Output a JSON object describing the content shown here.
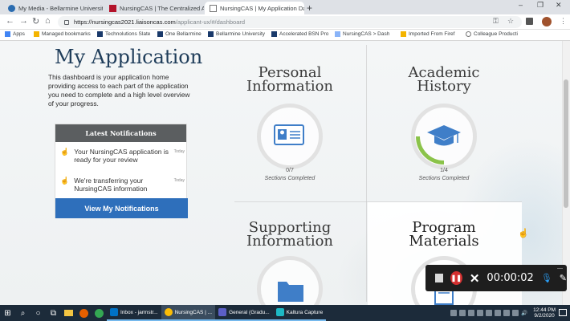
{
  "browser": {
    "tabs": [
      {
        "title": "My Media - Bellarmine Universit",
        "active": false
      },
      {
        "title": "NursingCAS | The Centralized Ap",
        "active": false
      },
      {
        "title": "NursingCAS | My Application Da",
        "active": true
      }
    ],
    "url_host": "https://nursingcas2021.liaisoncas.com",
    "url_path": "/applicant-ux/#/dashboard",
    "bookmarks": [
      "Apps",
      "Managed bookmarks",
      "Technolutions Slate",
      "One Bellarmine",
      "Bellarmine University",
      "Accelerated BSN Pro",
      "NursingCAS > Dash",
      "Imported From Firef",
      "Colleague Producti"
    ]
  },
  "page": {
    "title": "My Application",
    "intro": "This dashboard is your application home providing access to each part of the application you need to complete and a high level overview of your progress.",
    "notifications": {
      "heading": "Latest Notifications",
      "items": [
        {
          "text": "Your NursingCAS application is ready for your review",
          "when": "Today"
        },
        {
          "text": "We're transferring your NursingCAS information",
          "when": "Today"
        }
      ],
      "button": "View My Notifications"
    },
    "cards": [
      {
        "title_line1": "Personal",
        "title_line2": "Information",
        "count": "0/7",
        "subtitle": "Sections Completed",
        "progress": 0,
        "icon": "id-card-icon"
      },
      {
        "title_line1": "Academic",
        "title_line2": "History",
        "count": "1/4",
        "subtitle": "Sections Completed",
        "progress": 0.25,
        "icon": "graduation-cap-icon"
      },
      {
        "title_line1": "Supporting",
        "title_line2": "Information",
        "icon": "folder-icon"
      },
      {
        "title_line1": "Program",
        "title_line2": "Materials",
        "icon": "document-icon"
      }
    ]
  },
  "recorder": {
    "time": "00:00:02"
  },
  "taskbar": {
    "apps": [
      "Inbox - jarmstr...",
      "NursingCAS | ...",
      "General (Gradu...",
      "Kaltura Capture"
    ],
    "time": "12:44 PM",
    "date": "9/2/2020"
  },
  "colors": {
    "accent": "#2e6fbb",
    "title": "#1f3d5a",
    "progress": "#8bc34a",
    "icon": "#3f7ec8"
  }
}
